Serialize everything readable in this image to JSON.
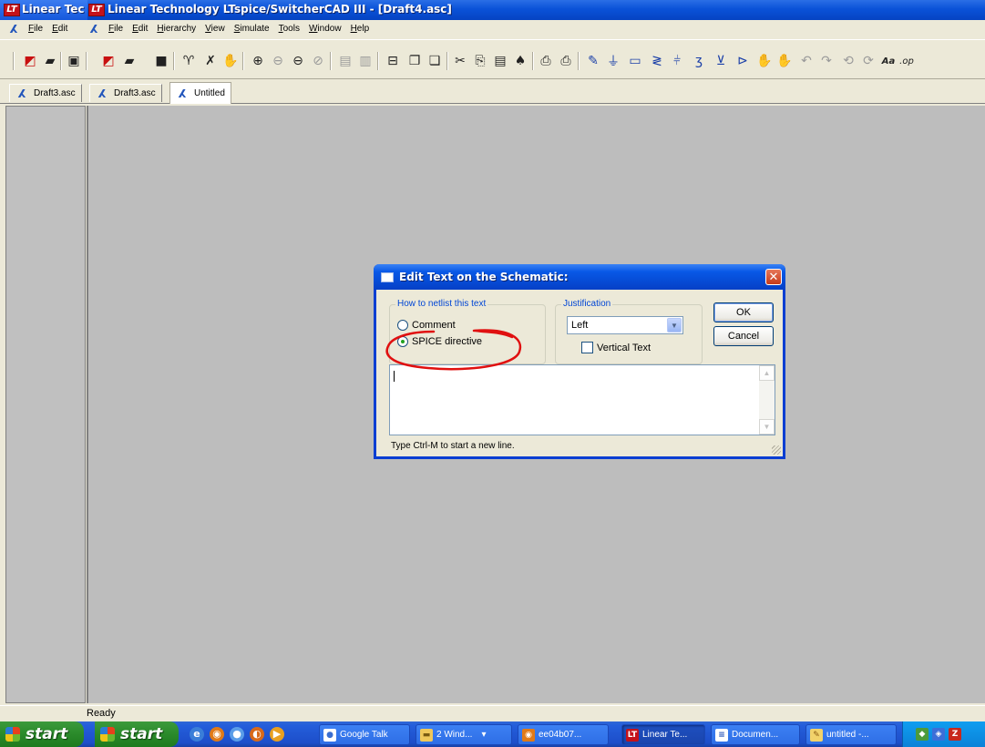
{
  "window": {
    "left_title": "Linear Tec",
    "title": "Linear Technology LTspice/SwitcherCAD III - [Draft4.asc]",
    "logo_glyph": "LT"
  },
  "menu_left": [
    "File",
    "Edit"
  ],
  "menu_main": [
    "File",
    "Edit",
    "Hierarchy",
    "View",
    "Simulate",
    "Tools",
    "Window",
    "Help"
  ],
  "toolbar": {
    "aa_label": "Aa",
    "op_label": ".op"
  },
  "tabs": [
    {
      "label": "Draft3.asc"
    },
    {
      "label": "Draft3.asc"
    },
    {
      "label": "Untitled"
    }
  ],
  "status": {
    "text": "Ready"
  },
  "taskbar": {
    "start_label": "start",
    "tasks": [
      {
        "label": "Google Talk"
      },
      {
        "label": "2 Wind..."
      },
      {
        "label": "ee04b07..."
      },
      {
        "label": "Linear Te..."
      },
      {
        "label": "Documen..."
      },
      {
        "label": "untitled -..."
      }
    ]
  },
  "dialog": {
    "title": "Edit Text on the Schematic:",
    "netlist_group": "How to netlist this text",
    "option_comment": "Comment",
    "option_spice": "SPICE directive",
    "justification_group": "Justification",
    "justification_value": "Left",
    "vertical_text": "Vertical Text",
    "ok_label": "OK",
    "cancel_label": "Cancel",
    "text_value": "",
    "hint": "Type Ctrl-M to start a new line."
  },
  "colors": {
    "titlebar": "#0a52d8",
    "workspace": "#bdbdbd",
    "annotation": "#e01010",
    "taskbar": "#245edb",
    "start_button": "#2a8a2a"
  }
}
